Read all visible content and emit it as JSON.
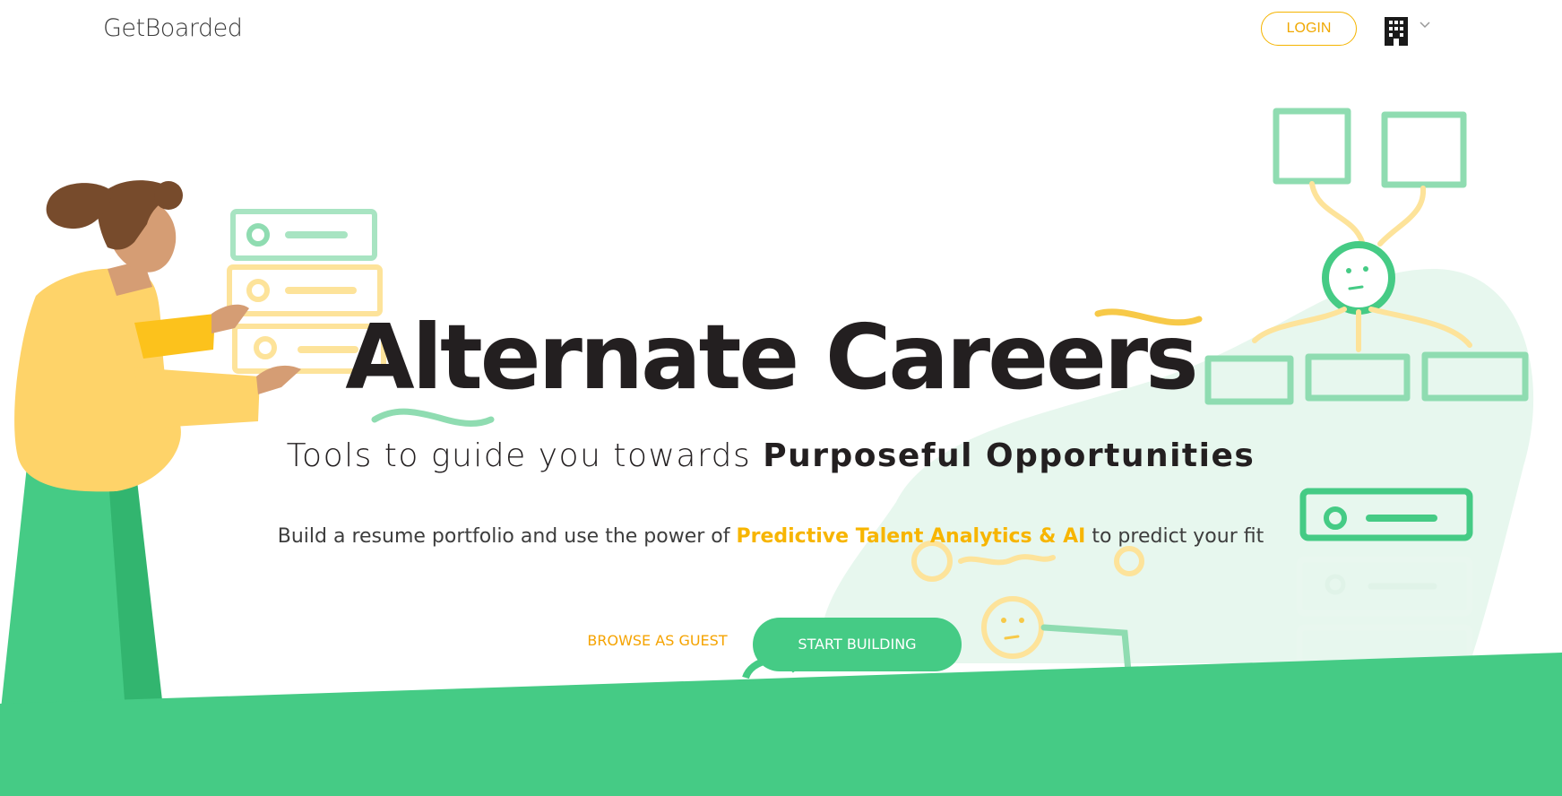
{
  "header": {
    "logo": "GetBoarded",
    "login_label": "LOGIN",
    "company_menu_icon": "building-icon"
  },
  "hero": {
    "headline": "Alternate Careers",
    "subhead_prefix": "Tools to guide you towards ",
    "subhead_bold": "Purposeful Opportunities",
    "desc_prefix": "Build a resume portfolio and use the power of ",
    "desc_highlight": "Predictive Talent Analytics & AI",
    "desc_suffix": " to predict your fit"
  },
  "actions": {
    "browse_label": "BROWSE AS GUEST",
    "start_label": "START BUILDING"
  },
  "colors": {
    "brand_green": "#45cb85",
    "accent_yellow": "#f7b500",
    "light_green": "#8fdcb1",
    "light_yellow": "#fde39a"
  }
}
